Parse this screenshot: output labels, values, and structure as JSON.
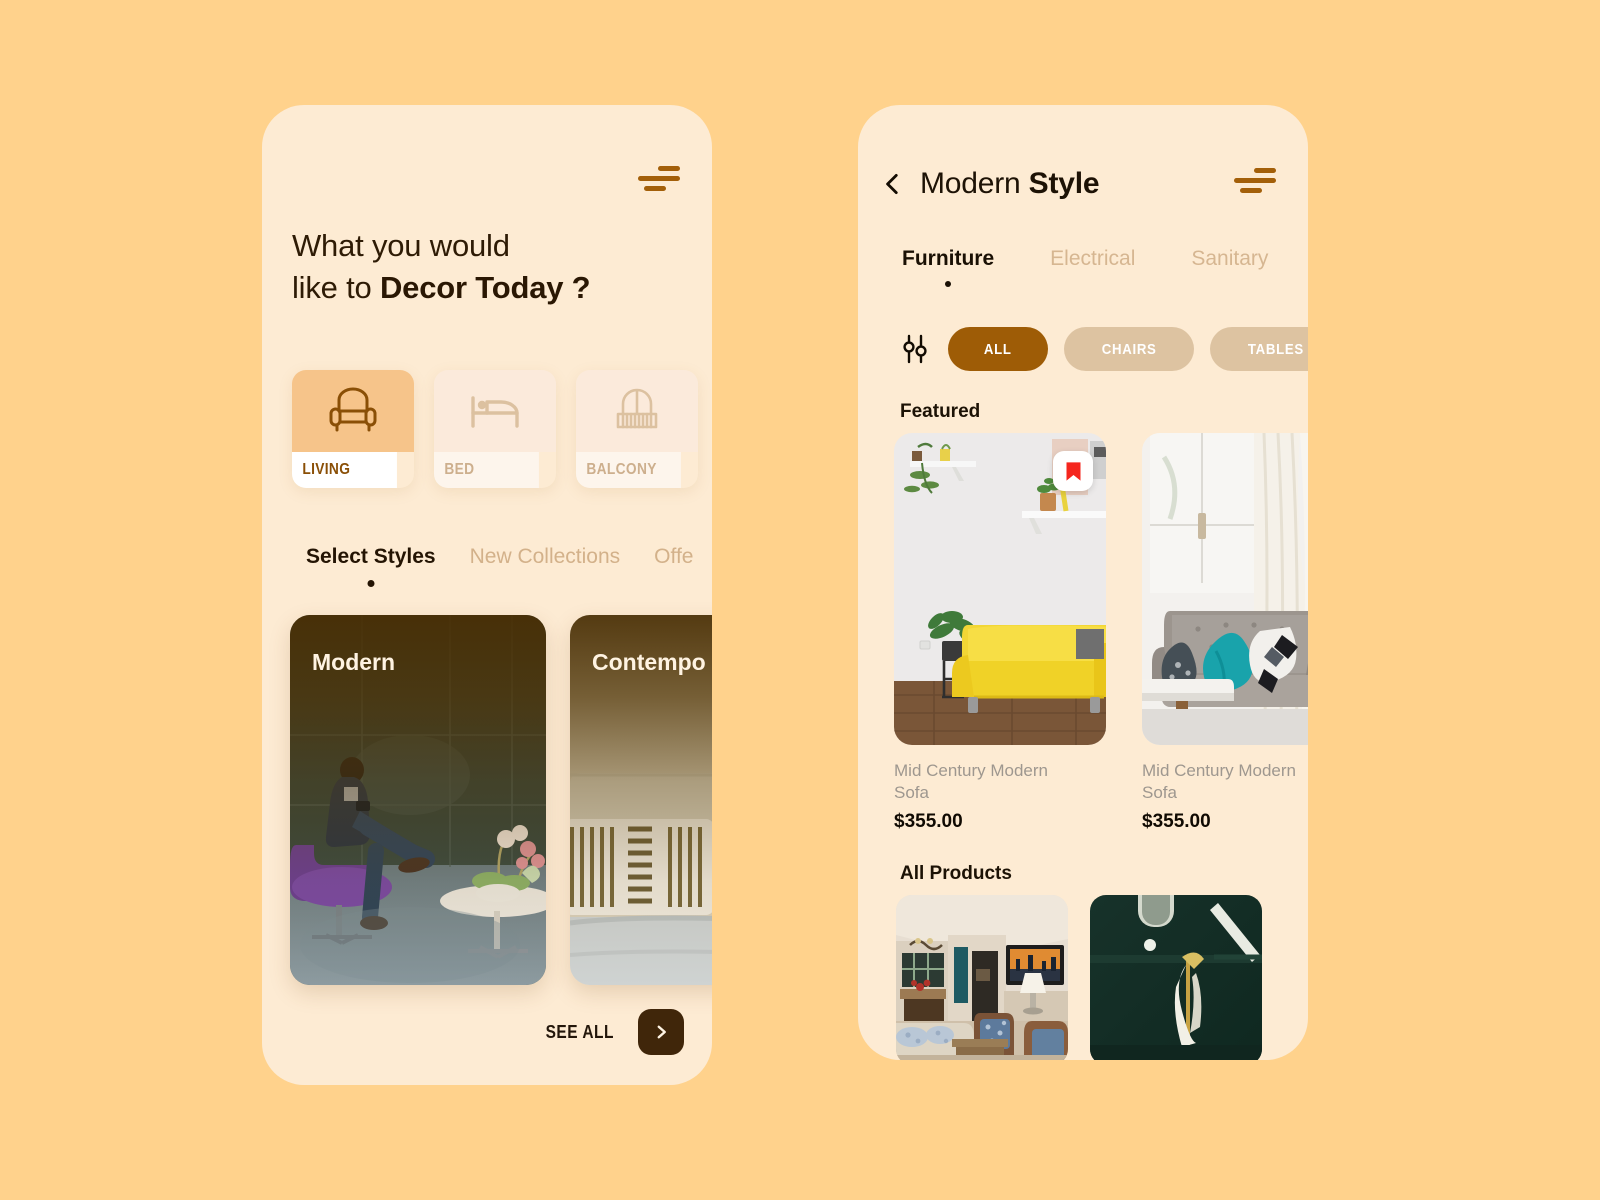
{
  "background_color": "#FFD28C",
  "phone_bg": "#FDEBD3",
  "accent_brown": "#9E5C06",
  "left_screen": {
    "menu_icon": "hamburger-icon",
    "heading_line1": "What you would",
    "heading_line2_plain": "like to ",
    "heading_line2_bold": "Decor Today ?",
    "categories": [
      {
        "label": "LIVING",
        "icon": "armchair-icon",
        "active": true
      },
      {
        "label": "BED",
        "icon": "bed-icon",
        "active": false
      },
      {
        "label": "BALCONY",
        "icon": "balcony-icon",
        "active": false
      }
    ],
    "tabs": [
      {
        "label": "Select Styles",
        "active": true
      },
      {
        "label": "New Collections",
        "active": false
      },
      {
        "label": "Offe",
        "active": false
      }
    ],
    "style_cards": [
      {
        "name": "Modern",
        "scene": "man-in-purple-chair-lounge"
      },
      {
        "name": "Contempo",
        "scene": "beige-sofa-striped-pillows"
      }
    ],
    "see_all_label": "SEE ALL",
    "see_all_icon": "chevron-right-icon"
  },
  "right_screen": {
    "back_icon": "chevron-left-icon",
    "title_plain": "Modern ",
    "title_bold": "Style",
    "menu_icon": "hamburger-icon",
    "tabs": [
      {
        "label": "Furniture",
        "active": true
      },
      {
        "label": "Electrical",
        "active": false
      },
      {
        "label": "Sanitary",
        "active": false
      }
    ],
    "filter_icon": "sliders-icon",
    "chips": [
      {
        "label": "ALL",
        "active": true
      },
      {
        "label": "CHAIRS",
        "active": false
      },
      {
        "label": "TABLES",
        "active": false
      },
      {
        "label": "",
        "active": false
      }
    ],
    "featured_heading": "Featured",
    "featured_products": [
      {
        "name": "Mid Century Modern Sofa",
        "price": "$355.00",
        "scene": "yellow-sofa-white-wall",
        "bookmarked": true,
        "bookmark_color": "#F5261E"
      },
      {
        "name": "Mid Century Modern Sofa",
        "price": "$355.00",
        "scene": "gray-tufted-sofa-teal-pillow",
        "bookmarked": false
      }
    ],
    "all_products_heading": "All Products",
    "all_products": [
      {
        "scene": "open-plan-living-room"
      },
      {
        "scene": "dark-green-wall-bird-lamp"
      }
    ]
  }
}
